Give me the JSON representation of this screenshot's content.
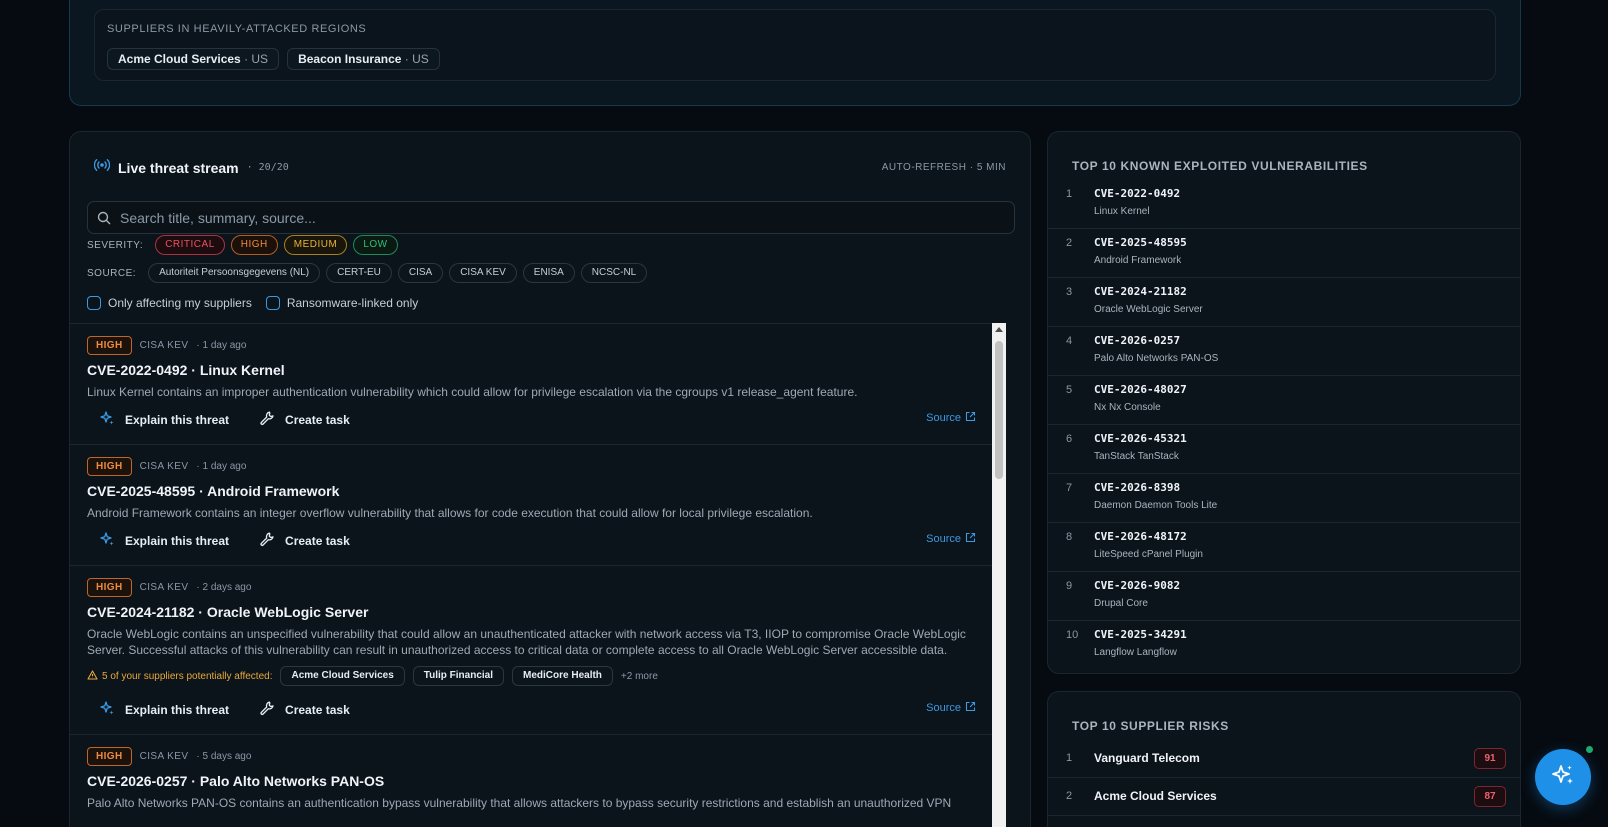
{
  "regions": {
    "title": "SUPPLIERS IN HEAVILY-ATTACKED REGIONS",
    "chips": [
      {
        "name": "Acme Cloud Services",
        "country": "· US"
      },
      {
        "name": "Beacon Insurance",
        "country": "· US"
      }
    ]
  },
  "stream": {
    "title": "Live threat stream",
    "count": "· 20/20",
    "auto_refresh": "AUTO-REFRESH · 5 MIN",
    "search_placeholder": "Search title, summary, source...",
    "severity_label": "SEVERITY:",
    "severities": [
      {
        "label": "CRITICAL",
        "color": "#e8525d"
      },
      {
        "label": "HIGH",
        "color": "#f08a3c"
      },
      {
        "label": "MEDIUM",
        "color": "#e8b33a"
      },
      {
        "label": "LOW",
        "color": "#2fbf7a"
      }
    ],
    "source_label": "SOURCE:",
    "sources": [
      "Autoriteit Persoonsgegevens (NL)",
      "CERT-EU",
      "CISA",
      "CISA KEV",
      "ENISA",
      "NCSC-NL"
    ],
    "check_suppliers": "Only affecting my suppliers",
    "check_ransomware": "Ransomware-linked only",
    "explain_label": "Explain this threat",
    "task_label": "Create task",
    "source_link": "Source",
    "items": [
      {
        "severity": "HIGH",
        "source": "CISA KEV",
        "age": "· 1 day ago",
        "title": "CVE-2022-0492 · Linux Kernel",
        "summary": "Linux Kernel contains an improper authentication vulnerability which could allow for privilege escalation via the cgroups v1 release_agent feature."
      },
      {
        "severity": "HIGH",
        "source": "CISA KEV",
        "age": "· 1 day ago",
        "title": "CVE-2025-48595 · Android Framework",
        "summary": "Android Framework contains an integer overflow vulnerability that allows for code execution that could allow for local privilege escalation."
      },
      {
        "severity": "HIGH",
        "source": "CISA KEV",
        "age": "· 2 days ago",
        "title": "CVE-2024-21182 · Oracle WebLogic Server",
        "summary": "Oracle WebLogic contains an unspecified vulnerability that could allow an unauthenticated attacker with network access via T3, IIOP to compromise Oracle WebLogic Server. Successful attacks of this vulnerability can result in unauthorized access to critical data or complete access to all Oracle WebLogic Server accessible data.",
        "affected_text": "5 of your suppliers potentially affected:",
        "affected": [
          "Acme Cloud Services",
          "Tulip Financial",
          "MediCore Health"
        ],
        "affected_more": "+2 more"
      },
      {
        "severity": "HIGH",
        "source": "CISA KEV",
        "age": "· 5 days ago",
        "title": "CVE-2026-0257 · Palo Alto Networks PAN-OS",
        "summary": "Palo Alto Networks PAN-OS contains an authentication bypass vulnerability that allows attackers to bypass security restrictions and establish an unauthorized VPN"
      }
    ]
  },
  "kev": {
    "title": "TOP 10 KNOWN EXPLOITED VULNERABILITIES",
    "items": [
      {
        "rank": "1",
        "cve": "CVE-2022-0492",
        "product": "Linux Kernel"
      },
      {
        "rank": "2",
        "cve": "CVE-2025-48595",
        "product": "Android Framework"
      },
      {
        "rank": "3",
        "cve": "CVE-2024-21182",
        "product": "Oracle WebLogic Server"
      },
      {
        "rank": "4",
        "cve": "CVE-2026-0257",
        "product": "Palo Alto Networks PAN-OS"
      },
      {
        "rank": "5",
        "cve": "CVE-2026-48027",
        "product": "Nx Nx Console"
      },
      {
        "rank": "6",
        "cve": "CVE-2026-45321",
        "product": "TanStack TanStack"
      },
      {
        "rank": "7",
        "cve": "CVE-2026-8398",
        "product": "Daemon Daemon Tools Lite"
      },
      {
        "rank": "8",
        "cve": "CVE-2026-48172",
        "product": "LiteSpeed cPanel Plugin"
      },
      {
        "rank": "9",
        "cve": "CVE-2026-9082",
        "product": "Drupal Core"
      },
      {
        "rank": "10",
        "cve": "CVE-2025-34291",
        "product": "Langflow Langflow"
      }
    ]
  },
  "suppliers": {
    "title": "TOP 10 SUPPLIER RISKS",
    "items": [
      {
        "rank": "1",
        "name": "Vanguard Telecom",
        "score": "91"
      },
      {
        "rank": "2",
        "name": "Acme Cloud Services",
        "score": "87"
      }
    ]
  },
  "colors": {
    "accent": "#1e90e8",
    "high": "#f08a3c",
    "critical": "#e8525d",
    "warning": "#e8a83a"
  }
}
